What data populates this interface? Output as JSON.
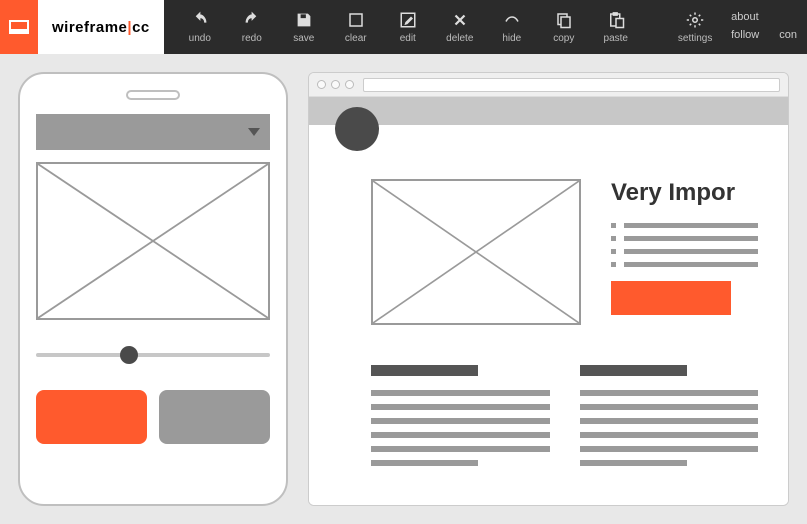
{
  "brand": {
    "name_a": "wireframe",
    "sep": "|",
    "name_b": "cc"
  },
  "toolbar": {
    "undo": "undo",
    "redo": "redo",
    "save": "save",
    "clear": "clear",
    "edit": "edit",
    "delete": "delete",
    "hide": "hide",
    "copy": "copy",
    "paste": "paste",
    "settings": "settings"
  },
  "links": {
    "about": "about",
    "follow": "follow",
    "contact": "con"
  },
  "page": {
    "headline": "Very Impor"
  },
  "colors": {
    "accent": "#ff5a2d",
    "toolbar_bg": "#2b2b2b",
    "placeholder": "#9a9a9a",
    "dark": "#4a4a4a"
  }
}
